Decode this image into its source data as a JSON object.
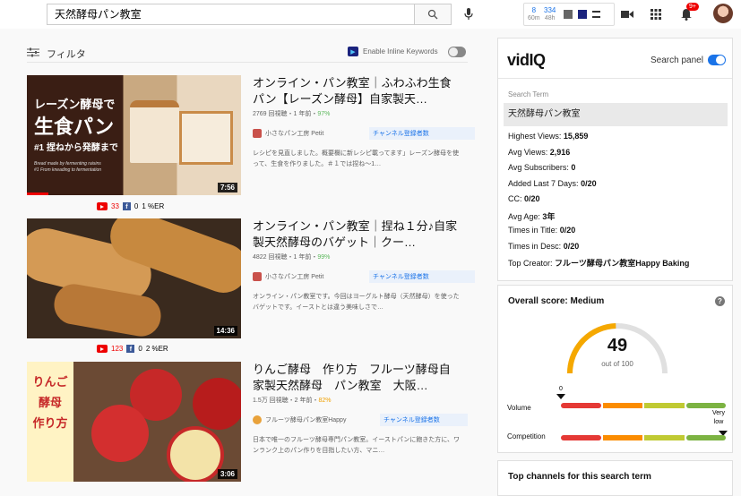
{
  "search": {
    "query": "天然酵母パン教室"
  },
  "ext_stats": {
    "v1": "8",
    "v1_sub": "60m",
    "v2": "334",
    "v2_sub": "48h"
  },
  "filter": {
    "label": "フィルタ",
    "inline_label": "Enable Inline Keywords"
  },
  "notifications": {
    "badge": "9+"
  },
  "videos": [
    {
      "title": "オンライン・パン教室｜ふわふわ生食パン【レーズン酵母】自家製天…",
      "views": "2769 回視聴・1 年前・",
      "score": "97%",
      "channel": "小さなパン工房 Petit",
      "tag": "チャンネル登録者数",
      "desc": "レシピを見直しました。概要欄に新レシピ載ってます」レーズン酵母を使って、生食を作りました。＃１では捏ね～1…",
      "duration": "7:56",
      "thumb_line1": "レーズン酵母で",
      "thumb_line2": "生食パン",
      "thumb_line3": "#1 捏ねから発酵まで",
      "thumb_line4": "Bread made by fermenting raisins",
      "thumb_line5": "#1 From kneading to fermentation",
      "yt": "33",
      "fb": "0",
      "er": "1 %ER"
    },
    {
      "title": "オンライン・パン教室｜捏ね１分♪自家製天然酵母のバゲット｜クー…",
      "views": "4822 回視聴・1 年前・",
      "score": "99%",
      "channel": "小さなパン工房 Petit",
      "tag": "チャンネル登録者数",
      "desc": "オンライン・パン教室です。今回はヨーグルト酵母（天然酵母）を使ったバゲットです。イーストとは違う美味しさで…",
      "duration": "14:36",
      "yt": "123",
      "fb": "0",
      "er": "2 %ER"
    },
    {
      "title": "りんご酵母　作り方　フルーツ酵母自家製天然酵母　パン教室　大阪…",
      "views": "1.5万 回視聴・2 年前・",
      "score": "82%",
      "channel": "フルーツ酵母パン教室Happy",
      "tag": "チャンネル登録者数",
      "desc": "日本で唯一のフルーツ酵母専門パン教室。イーストパンに飽きた方に、ワンランク上のパン作りを目指したい方、マニ…",
      "duration": "3:06",
      "thumb_line1": "りんご",
      "thumb_line2": "酵母",
      "thumb_line3": "作り方"
    }
  ],
  "vidiq": {
    "logo_a": "vid",
    "logo_b": "IQ",
    "search_panel": "Search panel",
    "search_term_label": "Search Term",
    "search_term": "天然酵母パン教室",
    "stats": [
      {
        "k": "Highest Views: ",
        "v": "15,859"
      },
      {
        "k": "Avg Views: ",
        "v": "2,916"
      },
      {
        "k": "Avg Subscribers: ",
        "v": "0"
      },
      {
        "k": "Added Last 7 Days: ",
        "v": "0/20"
      },
      {
        "k": "CC: ",
        "v": "0/20"
      },
      {
        "k": "Avg Age: ",
        "v": "3年"
      },
      {
        "k": "Times in Title: ",
        "v": "0/20"
      },
      {
        "k": "Times in Desc: ",
        "v": "0/20"
      },
      {
        "k": "Top Creator: ",
        "v": "フルーツ酵母パン教室Happy Baking"
      }
    ],
    "overall": "Overall score: Medium",
    "score": "49",
    "score_sub": "out of 100",
    "score_fraction": 0.49,
    "volume_label": "Volume",
    "competition_label": "Competition",
    "zero": "0",
    "very": "Very",
    "low": "low",
    "help": "?",
    "top_channels": "Top channels for this search term"
  },
  "colors": {
    "accent": "#1a73e8",
    "gauge": "#f5a800",
    "red": "#e53935",
    "orange": "#fb8c00",
    "yellow": "#c0ca33",
    "green": "#7cb342"
  }
}
